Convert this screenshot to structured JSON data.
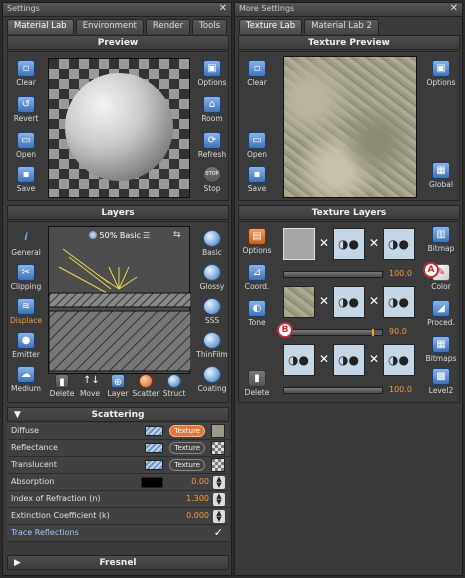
{
  "left_window": {
    "title": "Settings",
    "close": "✕",
    "tabs": [
      "Material Lab",
      "Environment",
      "Render",
      "Tools"
    ],
    "preview": {
      "header": "Preview",
      "left_buttons": [
        "Clear",
        "Revert",
        "Open",
        "Save"
      ],
      "right_buttons": [
        "Options",
        "Room",
        "Refresh",
        "Stop"
      ],
      "stop_glyph": "STOP"
    },
    "layers": {
      "header": "Layers",
      "left_buttons": [
        "General",
        "Clipping",
        "Displace",
        "Emitter",
        "Medium"
      ],
      "right_buttons": [
        "Basic",
        "Glossy",
        "SSS",
        "ThinFilm",
        "Coating"
      ],
      "bottom_buttons": [
        "Delete",
        "Move",
        "Layer",
        "Scatter",
        "Struct"
      ],
      "canvas_label": "50% Basic"
    },
    "scattering": {
      "header": "Scattering",
      "rows": [
        {
          "label": "Diffuse",
          "texture": "Texture"
        },
        {
          "label": "Reflectance",
          "texture": "Texture"
        },
        {
          "label": "Translucent",
          "texture": "Texture"
        },
        {
          "label": "Absorption",
          "value": "0.00"
        },
        {
          "label": "Index of Refraction (n)",
          "value": "1.300"
        },
        {
          "label": "Extinction Coefficient (k)",
          "value": "0.000"
        },
        {
          "label": "Trace Reflections",
          "check": "✓"
        }
      ]
    },
    "fresnel": {
      "header": "Fresnel"
    }
  },
  "right_window": {
    "title": "More Settings",
    "close": "✕",
    "tabs": [
      "Texture Lab",
      "Material Lab 2"
    ],
    "texture_preview": {
      "header": "Texture Preview",
      "left_buttons": [
        "Clear",
        "Open",
        "Save"
      ],
      "right_buttons": [
        "Options",
        "Global"
      ]
    },
    "texture_layers": {
      "header": "Texture Layers",
      "left_buttons": [
        "Options",
        "Coord.",
        "Tone",
        "Delete"
      ],
      "right_buttons": [
        "Bitmap",
        "Color",
        "Proced.",
        "Bitmaps",
        "Level2"
      ],
      "rows": [
        {
          "value": "100.0",
          "level": 1.0
        },
        {
          "value": "90.0",
          "level": 0.9
        },
        {
          "value": "100.0",
          "level": 1.0
        }
      ],
      "callouts": [
        "A",
        "B"
      ],
      "multiply": "✕"
    }
  },
  "colors": {
    "accent": "#f0a030",
    "button_blue": "#3f73b8",
    "callout": "#c43030"
  }
}
